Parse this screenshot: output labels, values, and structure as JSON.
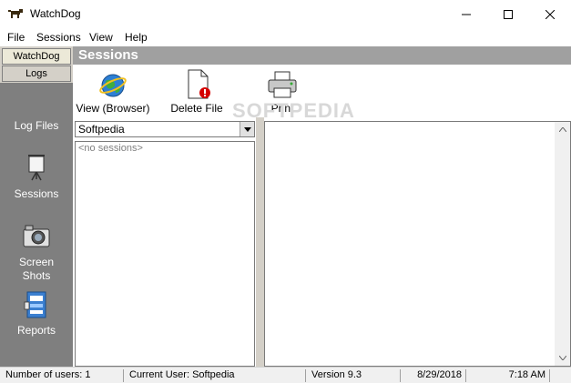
{
  "window": {
    "title": "WatchDog",
    "icons": [
      "dog-icon",
      "minimize-icon",
      "maximize-icon",
      "close-icon"
    ]
  },
  "menu": {
    "items": [
      "File",
      "Sessions",
      "View",
      "Help"
    ]
  },
  "left_tabs": [
    "WatchDog",
    "Logs"
  ],
  "nav": {
    "items": [
      {
        "label": "Log Files",
        "icon": ""
      },
      {
        "label": "Sessions",
        "icon": "projector-screen-icon"
      },
      {
        "label": "Screen\nShots",
        "icon": "camera-icon"
      },
      {
        "label": "Reports",
        "icon": "report-icon"
      }
    ]
  },
  "header": {
    "title": "Sessions"
  },
  "toolbar": {
    "view_label": "View (Browser)",
    "delete_label": "Delete File",
    "print_label": "Print",
    "watermark": "SOFTPEDIA"
  },
  "sessions": {
    "user_selected": "Softpedia",
    "empty_text": "<no sessions>"
  },
  "status": {
    "users": "Number of users: 1",
    "current_user": "Current User: Softpedia",
    "version": "Version 9.3",
    "date": "8/29/2018",
    "time": "7:18 AM"
  },
  "colors": {
    "nav_bg": "#7f7f7f",
    "header_bg": "#a0a0a0",
    "tab_bg": "#d4d0c8"
  }
}
